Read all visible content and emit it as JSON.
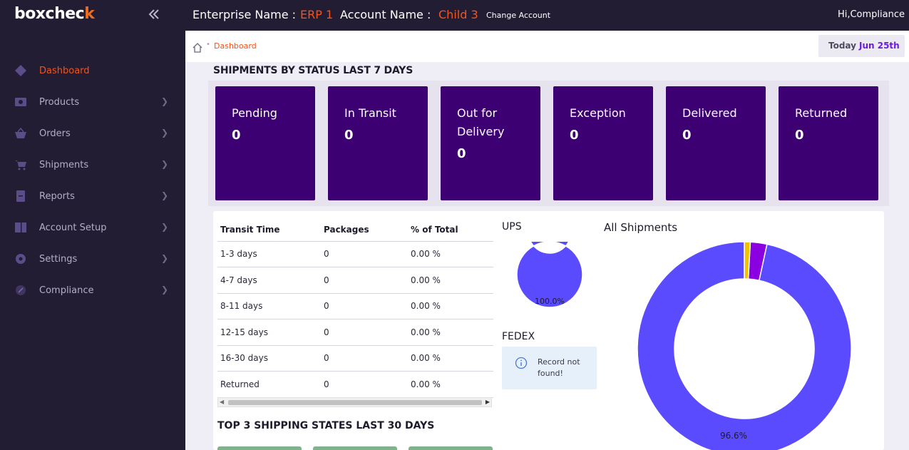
{
  "sidebar": {
    "logo_main": "boxchec",
    "logo_tick": "k",
    "collapse_icon": "double-chevron-left-icon",
    "items": [
      {
        "label": "Dashboard",
        "icon": "diamond-icon",
        "active": true
      },
      {
        "label": "Products",
        "icon": "image-icon",
        "active": false
      },
      {
        "label": "Orders",
        "icon": "basket-icon",
        "active": false
      },
      {
        "label": "Shipments",
        "icon": "cart-icon",
        "active": false
      },
      {
        "label": "Reports",
        "icon": "report-icon",
        "active": false
      },
      {
        "label": "Account Setup",
        "icon": "account-setup-icon",
        "active": false
      },
      {
        "label": "Settings",
        "icon": "gear-icon",
        "active": false
      },
      {
        "label": "Compliance",
        "icon": "compliance-icon",
        "active": false
      }
    ]
  },
  "topbar": {
    "enterprise_label": "Enterprise Name :",
    "enterprise_value": "ERP 1",
    "account_label": "Account Name :",
    "account_value": "Child 3",
    "change_account": "Change Account",
    "greeting": "Hi,Compliance"
  },
  "breadcrumb": {
    "current": "Dashboard",
    "today_label": "Today",
    "today_date": "Jun 25th"
  },
  "status": {
    "title": "SHIPMENTS BY STATUS LAST 7 DAYS",
    "cards": [
      {
        "label": "Pending",
        "value": "0"
      },
      {
        "label": "In Transit",
        "value": "0"
      },
      {
        "label": "Out for Delivery",
        "value": "0"
      },
      {
        "label": "Exception",
        "value": "0"
      },
      {
        "label": "Delivered",
        "value": "0"
      },
      {
        "label": "Returned",
        "value": "0"
      }
    ]
  },
  "transit_table": {
    "headers": [
      "Transit Time",
      "Packages",
      "% of Total"
    ],
    "rows": [
      [
        "1-3 days",
        "0",
        "0.00 %"
      ],
      [
        "4-7 days",
        "0",
        "0.00 %"
      ],
      [
        "8-11 days",
        "0",
        "0.00 %"
      ],
      [
        "12-15 days",
        "0",
        "0.00 %"
      ],
      [
        "16-30 days",
        "0",
        "0.00 %"
      ],
      [
        "Returned",
        "0",
        "0.00 %"
      ]
    ]
  },
  "top3": {
    "title": "TOP 3 SHIPPING STATES LAST 30 DAYS"
  },
  "ups": {
    "title": "UPS",
    "slice_label": "100.0%",
    "color": "#5b4bff"
  },
  "fedex": {
    "title": "FEDEX",
    "message": "Record not found!"
  },
  "all_shipments": {
    "title": "All Shipments",
    "main_label": "96.6%"
  },
  "colors": {
    "accent": "#f2541b",
    "card_bg": "#3c0072",
    "donut_main": "#5b4bff",
    "donut_purple": "#8a00e0",
    "donut_yellow": "#f2c200"
  },
  "chart_data": [
    {
      "type": "pie",
      "title": "UPS",
      "labels": [],
      "values": [
        100.0
      ],
      "data_labels": [
        "100.0%"
      ]
    },
    {
      "type": "pie",
      "title": "All Shipments",
      "labels": [],
      "values": [
        96.6,
        2.5,
        0.9
      ],
      "data_labels": [
        "96.6%"
      ]
    }
  ]
}
